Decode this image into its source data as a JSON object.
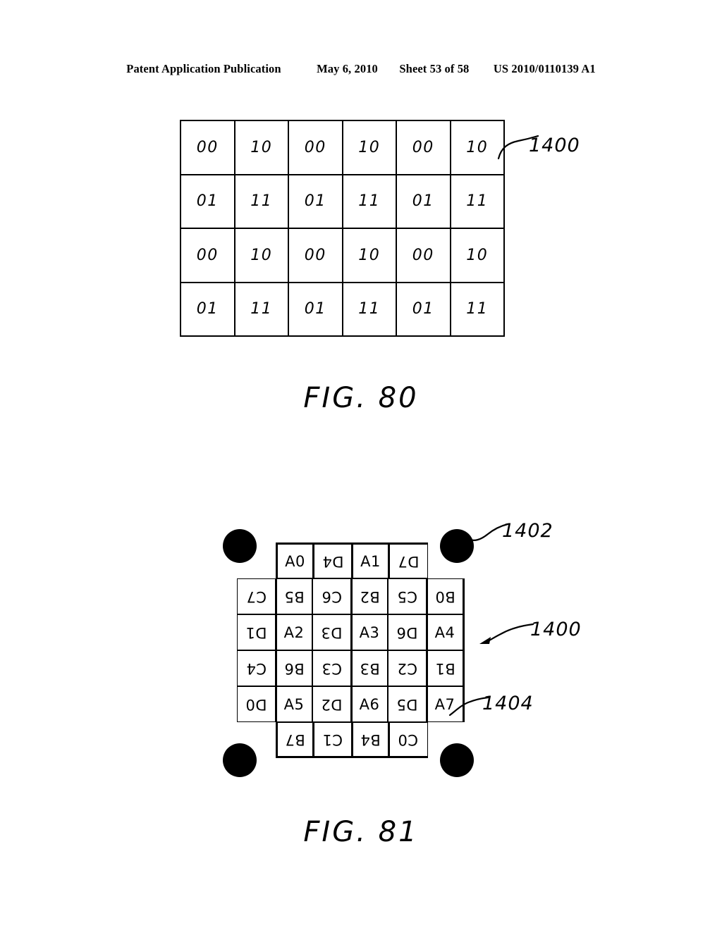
{
  "header": {
    "publication": "Patent Application Publication",
    "date": "May 6, 2010",
    "sheet": "Sheet 53 of 58",
    "patent_number": "US 2010/0110139 A1"
  },
  "fig80": {
    "caption": "FIG. 80",
    "reference_label": "1400",
    "table": {
      "rows": 4,
      "cols": 6,
      "cells": [
        [
          "00",
          "10",
          "00",
          "10",
          "00",
          "10"
        ],
        [
          "01",
          "11",
          "01",
          "11",
          "01",
          "11"
        ],
        [
          "00",
          "10",
          "00",
          "10",
          "00",
          "10"
        ],
        [
          "01",
          "11",
          "01",
          "11",
          "01",
          "11"
        ]
      ]
    }
  },
  "fig81": {
    "caption": "FIG. 81",
    "reference_labels": {
      "dot": "1402",
      "grid": "1400",
      "cell": "1404"
    },
    "dots": [
      "top-left",
      "top-right",
      "bottom-left",
      "bottom-right"
    ],
    "grid": {
      "rows": [
        {
          "indent": true,
          "cells": [
            {
              "label": "A0",
              "rotated": false
            },
            {
              "label": "D4",
              "rotated": true
            },
            {
              "label": "A1",
              "rotated": false
            },
            {
              "label": "D7",
              "rotated": true
            }
          ]
        },
        {
          "indent": false,
          "cells": [
            {
              "label": "C7",
              "rotated": true
            },
            {
              "label": "B5",
              "rotated": true
            },
            {
              "label": "C6",
              "rotated": true
            },
            {
              "label": "B2",
              "rotated": true
            },
            {
              "label": "C5",
              "rotated": true
            },
            {
              "label": "B0",
              "rotated": true
            }
          ]
        },
        {
          "indent": false,
          "cells": [
            {
              "label": "D1",
              "rotated": true
            },
            {
              "label": "A2",
              "rotated": false
            },
            {
              "label": "D3",
              "rotated": true
            },
            {
              "label": "A3",
              "rotated": false
            },
            {
              "label": "D6",
              "rotated": true
            },
            {
              "label": "A4",
              "rotated": false
            }
          ]
        },
        {
          "indent": false,
          "cells": [
            {
              "label": "C4",
              "rotated": true
            },
            {
              "label": "B6",
              "rotated": true
            },
            {
              "label": "C3",
              "rotated": true
            },
            {
              "label": "B3",
              "rotated": true
            },
            {
              "label": "C2",
              "rotated": true
            },
            {
              "label": "B1",
              "rotated": true
            }
          ]
        },
        {
          "indent": false,
          "cells": [
            {
              "label": "D0",
              "rotated": true
            },
            {
              "label": "A5",
              "rotated": false
            },
            {
              "label": "D2",
              "rotated": true
            },
            {
              "label": "A6",
              "rotated": false
            },
            {
              "label": "D5",
              "rotated": true
            },
            {
              "label": "A7",
              "rotated": false
            }
          ]
        },
        {
          "indent": true,
          "cells": [
            {
              "label": "B7",
              "rotated": true
            },
            {
              "label": "C1",
              "rotated": true
            },
            {
              "label": "B4",
              "rotated": true
            },
            {
              "label": "C0",
              "rotated": true
            }
          ]
        }
      ]
    }
  },
  "colors": {
    "ink": "#000000",
    "page": "#ffffff"
  }
}
